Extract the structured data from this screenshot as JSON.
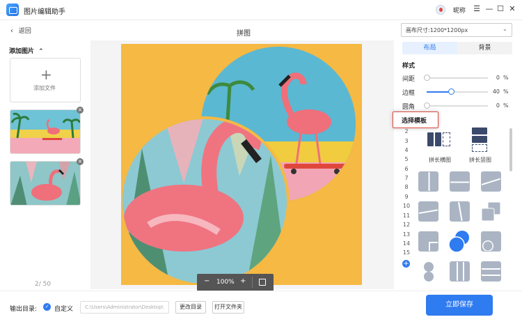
{
  "app": {
    "title": "图片编辑助手",
    "user_name": "昵称"
  },
  "window_controls": [
    "☰",
    "—",
    "☐",
    "✕"
  ],
  "toolbar": {
    "back_label": "返回",
    "page_title": "拼图"
  },
  "left_panel": {
    "add_images_label": "添加图片",
    "add_file_label": "添加文件",
    "page_count": "2/ 50"
  },
  "zoom": {
    "minus": "−",
    "level": "100%",
    "plus": "+"
  },
  "bottom": {
    "output_label": "输出目录:",
    "custom_label": "自定义",
    "path_value": "C:\\Users\\Administrator\\Desktop\\",
    "change_dir_label": "更改目录",
    "open_folder_label": "打开文件夹",
    "save_label": "立即保存"
  },
  "right_panel": {
    "canvas_size_label": "画布尺寸:1200*1200px",
    "tabs": [
      "布局",
      "背景"
    ],
    "style_label": "样式",
    "sliders": [
      {
        "label": "间距",
        "value": 0,
        "unit": "%"
      },
      {
        "label": "边框",
        "value": 40,
        "unit": "%"
      },
      {
        "label": "圆角",
        "value": 0,
        "unit": "%"
      }
    ],
    "template_header": "选择模板",
    "counts": [
      "2",
      "3",
      "4",
      "5",
      "6",
      "7",
      "8",
      "9",
      "10",
      "11",
      "12",
      "13",
      "14",
      "15"
    ],
    "template_captions": [
      "拼长横图",
      "拼长竖图"
    ]
  },
  "colors": {
    "accent": "#2f7bf0",
    "canvas_bg": "#f5b944",
    "highlight_border": "#e0473c"
  }
}
